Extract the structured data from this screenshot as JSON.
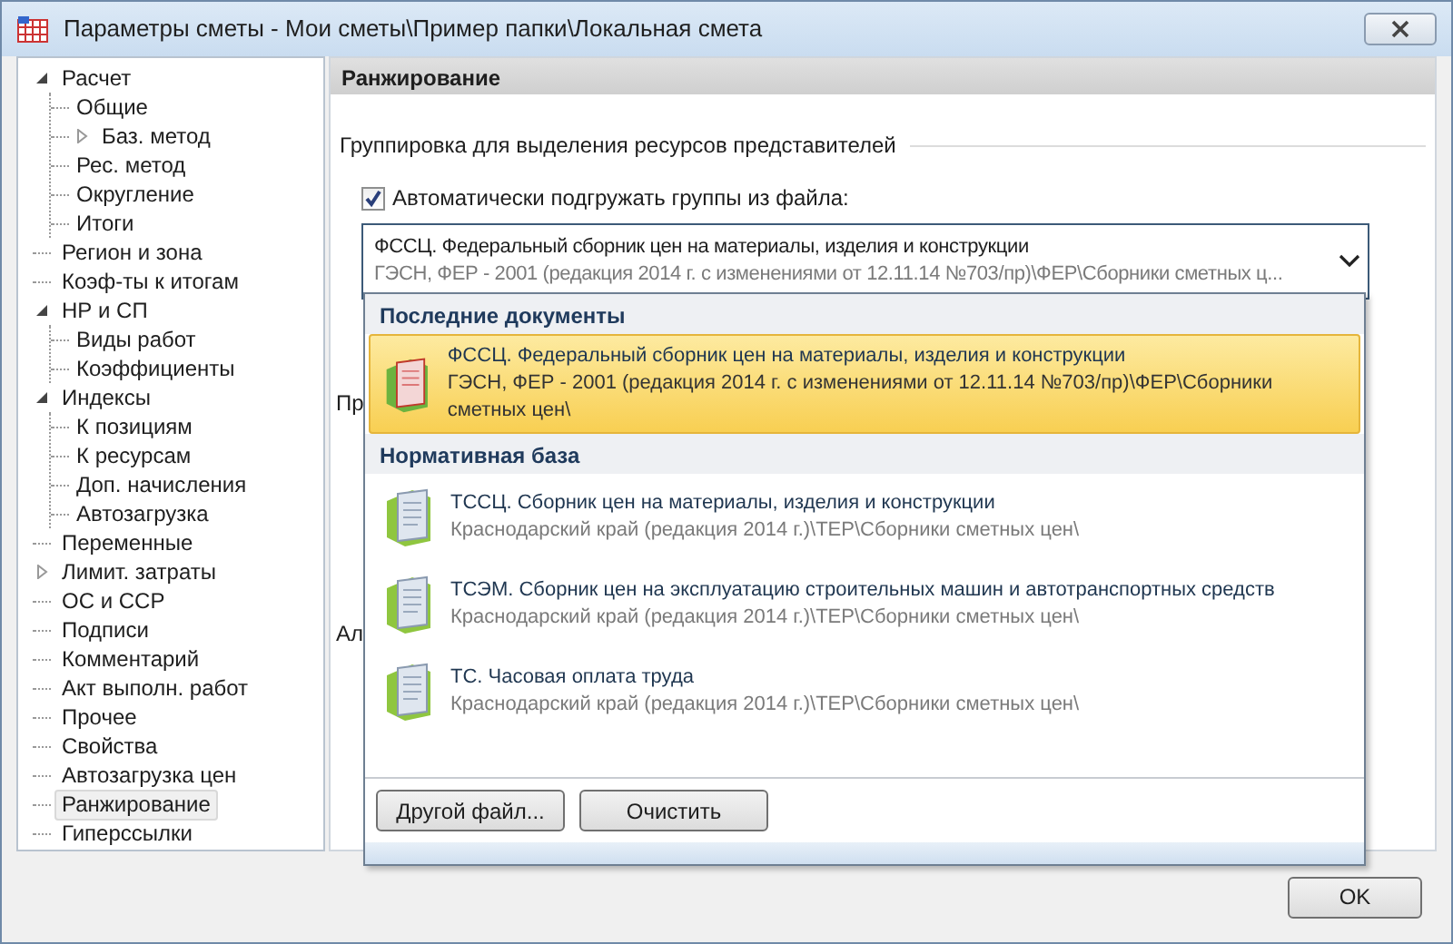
{
  "window": {
    "title": "Параметры сметы - Мои сметы\\Пример папки\\Локальная смета"
  },
  "sidebar": {
    "items": [
      {
        "label": "Расчет",
        "expanded": true,
        "selected": false,
        "children": [
          {
            "label": "Общие",
            "selected": false
          },
          {
            "label": "Баз. метод",
            "expanded": false,
            "selected": false
          },
          {
            "label": "Рес. метод",
            "selected": false
          },
          {
            "label": "Округление",
            "selected": false
          },
          {
            "label": "Итоги",
            "selected": false
          }
        ]
      },
      {
        "label": "Регион и зона",
        "selected": false
      },
      {
        "label": "Коэф-ты к итогам",
        "selected": false
      },
      {
        "label": "НР и СП",
        "expanded": true,
        "selected": false,
        "children": [
          {
            "label": "Виды работ",
            "selected": false
          },
          {
            "label": "Коэффициенты",
            "selected": false
          }
        ]
      },
      {
        "label": "Индексы",
        "expanded": true,
        "selected": false,
        "children": [
          {
            "label": "К позициям",
            "selected": false
          },
          {
            "label": "К ресурсам",
            "selected": false
          },
          {
            "label": "Доп. начисления",
            "selected": false
          },
          {
            "label": "Автозагрузка",
            "selected": false
          }
        ]
      },
      {
        "label": "Переменные",
        "selected": false
      },
      {
        "label": "Лимит. затраты",
        "expanded": false,
        "selected": false
      },
      {
        "label": "ОС и ССР",
        "selected": false
      },
      {
        "label": "Подписи",
        "selected": false
      },
      {
        "label": "Комментарий",
        "selected": false
      },
      {
        "label": "Акт выполн. работ",
        "selected": false
      },
      {
        "label": "Прочее",
        "selected": false
      },
      {
        "label": "Свойства",
        "selected": false
      },
      {
        "label": "Автозагрузка цен",
        "selected": false
      },
      {
        "label": "Ранжирование",
        "selected": true
      },
      {
        "label": "Гиперссылки",
        "selected": false
      }
    ]
  },
  "panel": {
    "title": "Ранжирование",
    "group_label": "Группировка для выделения ресурсов представителей",
    "auto_load": {
      "label": "Автоматически подгружать группы из файла:",
      "checked": true
    },
    "combo": {
      "title": "ФССЦ. Федеральный сборник цен на материалы, изделия и конструкции",
      "path": "ГЭСН, ФЕР - 2001 (редакция 2014 г. с изменениями от 12.11.14 №703/пр)\\ФЕР\\Сборники сметных ц..."
    },
    "hidden_labels": [
      "Пр",
      "Ал"
    ]
  },
  "dropdown": {
    "sections": [
      {
        "title": "Последние документы",
        "items": [
          {
            "title": "ФССЦ. Федеральный сборник цен на материалы, изделия и конструкции",
            "path": "ГЭСН, ФЕР - 2001 (редакция 2014 г. с изменениями от 12.11.14 №703/пр)\\ФЕР\\Сборники сметных цен\\",
            "selected": true
          }
        ]
      },
      {
        "title": "Нормативная база",
        "items": [
          {
            "title": "ТССЦ. Сборник цен на материалы, изделия и конструкции",
            "path": "Краснодарский край (редакция 2014 г.)\\ТЕР\\Сборники сметных цен\\",
            "selected": false
          },
          {
            "title": "ТСЭМ. Сборник цен на эксплуатацию строительных машин и автотранспортных средств",
            "path": "Краснодарский край (редакция 2014 г.)\\ТЕР\\Сборники сметных цен\\",
            "selected": false
          },
          {
            "title": "ТС. Часовая оплата труда",
            "path": "Краснодарский край (редакция 2014 г.)\\ТЕР\\Сборники сметных цен\\",
            "selected": false
          }
        ]
      }
    ],
    "buttons": [
      "Другой файл...",
      "Очистить"
    ]
  },
  "buttons": [
    "OK"
  ]
}
